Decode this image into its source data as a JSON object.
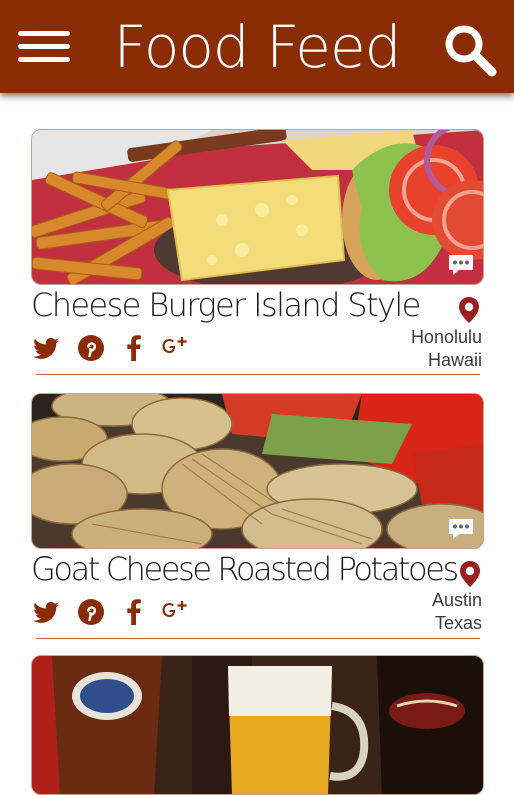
{
  "app": {
    "title": "Food Feed",
    "accent_color": "#8a2d06",
    "menu_icon": "hamburger-menu-icon",
    "search_icon": "search-icon"
  },
  "feed": {
    "posts": [
      {
        "title": "Cheese Burger Island Style",
        "city": "Honolulu",
        "region": "Hawaii",
        "photo": "cheeseburger-with-fries-photo",
        "share_icons": [
          "twitter-icon",
          "pinterest-icon",
          "facebook-icon",
          "google-plus-icon"
        ]
      },
      {
        "title": "Goat Cheese Roasted Potatoes",
        "city": "Austin",
        "region": "Texas",
        "photo": "roasted-potatoes-photo",
        "share_icons": [
          "twitter-icon",
          "pinterest-icon",
          "facebook-icon",
          "google-plus-icon"
        ]
      },
      {
        "title": "",
        "city": "",
        "region": "",
        "photo": "beer-glasses-photo"
      }
    ]
  }
}
